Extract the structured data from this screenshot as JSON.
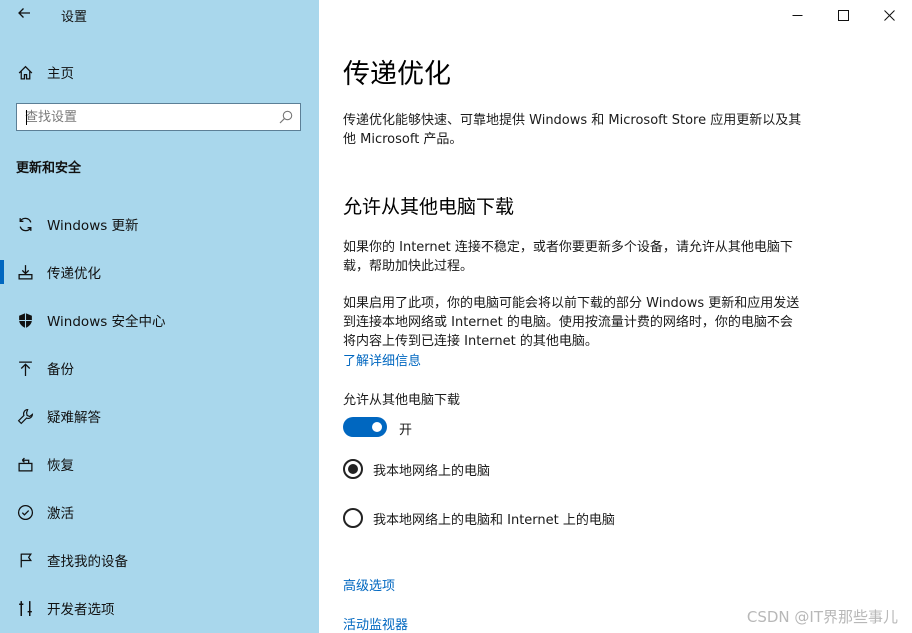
{
  "window": {
    "title": "设置"
  },
  "sidebar": {
    "home_label": "主页",
    "search_placeholder": "查找设置",
    "section_title": "更新和安全",
    "items": [
      {
        "label": "Windows 更新",
        "icon": "sync-icon",
        "selected": false
      },
      {
        "label": "传递优化",
        "icon": "delivery-optimization-icon",
        "selected": true
      },
      {
        "label": "Windows 安全中心",
        "icon": "shield-icon",
        "selected": false
      },
      {
        "label": "备份",
        "icon": "backup-arrow-icon",
        "selected": false
      },
      {
        "label": "疑难解答",
        "icon": "wrench-icon",
        "selected": false
      },
      {
        "label": "恢复",
        "icon": "recovery-icon",
        "selected": false
      },
      {
        "label": "激活",
        "icon": "check-circle-icon",
        "selected": false
      },
      {
        "label": "查找我的设备",
        "icon": "find-device-icon",
        "selected": false
      },
      {
        "label": "开发者选项",
        "icon": "developer-icon",
        "selected": false
      }
    ]
  },
  "main": {
    "title": "传递优化",
    "intro": "传递优化能够快速、可靠地提供 Windows 和 Microsoft Store 应用更新以及其他 Microsoft 产品。",
    "section_title": "允许从其他电脑下载",
    "para1": "如果你的 Internet 连接不稳定，或者你要更新多个设备，请允许从其他电脑下载，帮助加快此过程。",
    "para2": "如果启用了此项，你的电脑可能会将以前下载的部分 Windows 更新和应用发送到连接本地网络或 Internet 的电脑。使用按流量计费的网络时，你的电脑不会将内容上传到已连接 Internet 的其他电脑。",
    "learn_more": "了解详细信息",
    "toggle_label": "允许从其他电脑下载",
    "toggle_on": true,
    "toggle_state": "开",
    "radio_options": [
      {
        "label": "我本地网络上的电脑",
        "checked": true
      },
      {
        "label": "我本地网络上的电脑和 Internet 上的电脑",
        "checked": false
      }
    ],
    "advanced_link": "高级选项",
    "monitor_link": "活动监视器"
  },
  "watermark": "CSDN @IT界那些事儿",
  "colors": {
    "sidebar_bg": "#a9d7ec",
    "accent": "#0067c0"
  }
}
